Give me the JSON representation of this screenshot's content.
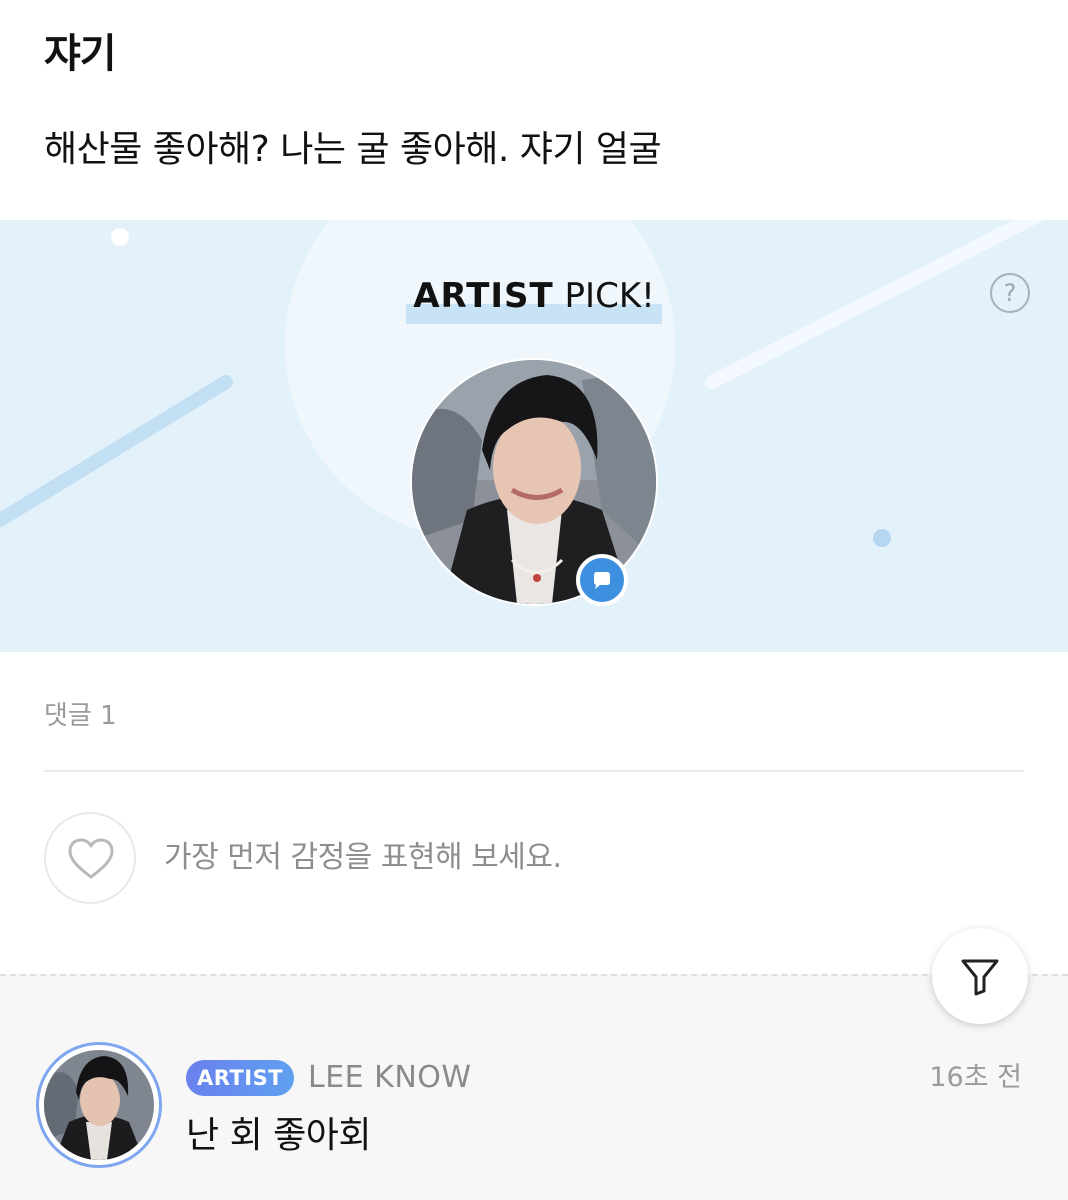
{
  "post": {
    "title": "쟈기",
    "body": "해산물 좋아해? 나는 굴 좋아해. 쟈기 얼굴"
  },
  "artist_pick": {
    "title_bold": "ARTIST",
    "title_rest": " PICK!",
    "help_label": "?",
    "banner_color": "#e3f1fb",
    "badge_color": "#3d90e0"
  },
  "comments": {
    "count_label": "댓글 1",
    "like_prompt": "가장 먼저 감정을 표현해 보세요.",
    "items": [
      {
        "tag": "ARTIST",
        "author": "LEE KNOW",
        "time": "16초 전",
        "text": "난 회 좋아회"
      }
    ]
  },
  "icons": {
    "help": "question-circle-icon",
    "comment": "speech-bubble-icon",
    "like": "heart-outline-icon",
    "filter": "funnel-icon"
  }
}
